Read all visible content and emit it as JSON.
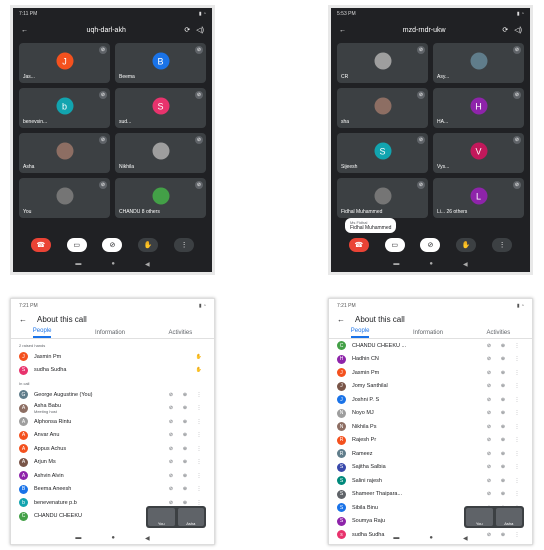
{
  "screen1": {
    "time": "7:11 PM",
    "meeting_code": "uqh-darl-akh",
    "tiles": [
      {
        "initial": "J",
        "name": "Jas...",
        "color": "#f4511e"
      },
      {
        "initial": "B",
        "name": "Beema",
        "color": "#1a73e8"
      },
      {
        "initial": "b",
        "name": "benevsin...",
        "color": "#12a4af"
      },
      {
        "initial": "S",
        "name": "sud...",
        "color": "#e8336d"
      },
      {
        "initial": "",
        "name": "Asha",
        "color": "#8d6e63"
      },
      {
        "initial": "",
        "name": "Nikhila",
        "color": "#9e9e9e"
      },
      {
        "initial": "",
        "name": "You",
        "color": "#757575"
      },
      {
        "initial": "",
        "name": "CHANDU  8 others",
        "color": "#43a047"
      }
    ]
  },
  "screen2": {
    "time": "5:53 PM",
    "meeting_code": "mzd-rndr-ukw",
    "tiles": [
      {
        "initial": "",
        "name": "CR",
        "color": "#9e9e9e"
      },
      {
        "initial": "",
        "name": "Asy...",
        "color": "#607d8b"
      },
      {
        "initial": "",
        "name": "sha",
        "color": "#8d6e63"
      },
      {
        "initial": "H",
        "name": "HA...",
        "color": "#8e24aa"
      },
      {
        "initial": "S",
        "name": "Sijeesh",
        "color": "#12a4af"
      },
      {
        "initial": "V",
        "name": "Vys...",
        "color": "#c2185b"
      },
      {
        "initial": "",
        "name": "Fidhal Muhammed",
        "color": "#757575"
      },
      {
        "initial": "L",
        "name": "Li... 26 others",
        "color": "#8e24aa"
      }
    ],
    "toast_label": "Ms Fidhal",
    "toast_name": "Fidhal Muhammed"
  },
  "screen3": {
    "time": "7:21 PM",
    "title": "About this call",
    "tabs": [
      "People",
      "Information",
      "Activities"
    ],
    "raised_label": "2 raised hands",
    "raised": [
      {
        "name": "Jasmin Pm",
        "color": "#f4511e",
        "initial": "J"
      },
      {
        "name": "sudha Sudha",
        "color": "#e8336d",
        "initial": "S"
      }
    ],
    "incall_label": "In call",
    "people": [
      {
        "name": "George Augustine (You)",
        "sub": "",
        "color": "#607d8b",
        "initial": "G"
      },
      {
        "name": "Asha Babu",
        "sub": "Meeting host",
        "color": "#8d6e63",
        "initial": "A"
      },
      {
        "name": "Alphonsa Rintu",
        "sub": "",
        "color": "#9e9e9e",
        "initial": "A"
      },
      {
        "name": "Anvar Anu",
        "sub": "",
        "color": "#f4511e",
        "initial": "A"
      },
      {
        "name": "Appus Achus",
        "sub": "",
        "color": "#f4511e",
        "initial": "A"
      },
      {
        "name": "Arjun Ms",
        "sub": "",
        "color": "#795548",
        "initial": "A"
      },
      {
        "name": "Ashvin Alvin",
        "sub": "",
        "color": "#8e24aa",
        "initial": "A"
      },
      {
        "name": "Beema Aneesh",
        "sub": "",
        "color": "#1a73e8",
        "initial": "B"
      },
      {
        "name": "benevenature p.b",
        "sub": "",
        "color": "#12a4af",
        "initial": "b"
      },
      {
        "name": "CHANDU CHEEKU",
        "sub": "",
        "color": "#43a047",
        "initial": "C"
      }
    ],
    "pip_left": "You",
    "pip_right": "Asha"
  },
  "screen4": {
    "time": "7:21 PM",
    "title": "About this call",
    "tabs": [
      "People",
      "Information",
      "Activities"
    ],
    "people": [
      {
        "name": "CHANDU CHEEKU ...",
        "color": "#43a047",
        "initial": "C"
      },
      {
        "name": "Hadhin CN",
        "color": "#8e24aa",
        "initial": "H"
      },
      {
        "name": "Jasmin Pm",
        "color": "#f4511e",
        "initial": "J"
      },
      {
        "name": "Jomy Santhilal",
        "color": "#795548",
        "initial": "J"
      },
      {
        "name": "Joshni P. S",
        "color": "#1a73e8",
        "initial": "J"
      },
      {
        "name": "Noyo MJ",
        "color": "#9e9e9e",
        "initial": "N"
      },
      {
        "name": "Nikhila Ps",
        "color": "#8d6e63",
        "initial": "N"
      },
      {
        "name": "Rajesh Pr",
        "color": "#f4511e",
        "initial": "R"
      },
      {
        "name": "Rameez",
        "color": "#607d8b",
        "initial": "R"
      },
      {
        "name": "Sajitha Salbia",
        "color": "#3949ab",
        "initial": "S"
      },
      {
        "name": "Salini rajesh",
        "color": "#00897b",
        "initial": "S"
      },
      {
        "name": "Shameer Thaipara...",
        "color": "#5f6368",
        "initial": "S"
      },
      {
        "name": "Sibila Binu",
        "color": "#1a73e8",
        "initial": "S"
      },
      {
        "name": "Soumya Raju",
        "color": "#8e24aa",
        "initial": "S"
      },
      {
        "name": "sudha Sudha",
        "color": "#e8336d",
        "initial": "s"
      }
    ],
    "pip_left": "You",
    "pip_right": "Asha"
  }
}
